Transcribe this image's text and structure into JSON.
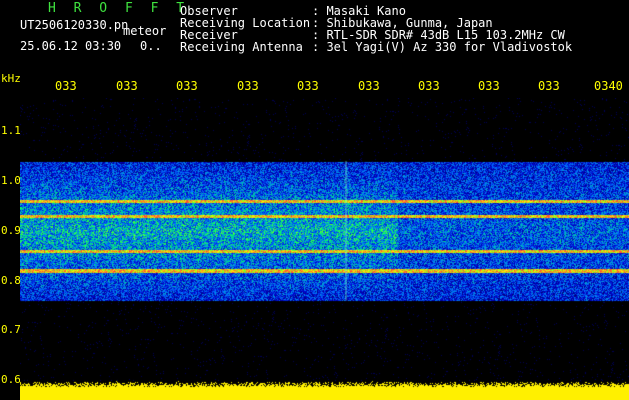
{
  "header": {
    "brand": "H R O F F T",
    "filename": "UT2506120330.pn",
    "mode": "meteor",
    "datetime": "25.06.12 03:30",
    "datetime_extra": "0..",
    "fields": [
      {
        "label": "Observer",
        "value": ": Masaki Kano"
      },
      {
        "label": "Receiving Location",
        "value": ": Shibukawa, Gunma, Japan"
      },
      {
        "label": "Receiver",
        "value": ": RTL-SDR SDR# 43dB L15 103.2MHz CW"
      },
      {
        "label": "Receiving Antenna",
        "value": ": 3el Yagi(V) Az 330 for Vladivostok"
      }
    ]
  },
  "chart_data": {
    "type": "heatmap",
    "ylabel": "kHz",
    "yticks": [
      "1.1",
      "1.0",
      "0.9",
      "0.8",
      "0.7",
      "0.6"
    ],
    "ylim": [
      0.6,
      1.15
    ],
    "xticks": [
      "033",
      "033",
      "033",
      "033",
      "033",
      "033",
      "033",
      "033",
      "033",
      "0340"
    ],
    "noise_band_khz": [
      0.76,
      1.04
    ],
    "carrier_lines_khz": [
      0.96,
      0.93,
      0.86,
      0.82
    ],
    "colors": {
      "label": "#ffff00",
      "brand": "#3fe23f",
      "noise": "#1a3cd0",
      "signal": "#ff3050",
      "baseline": "#ffff00"
    }
  }
}
